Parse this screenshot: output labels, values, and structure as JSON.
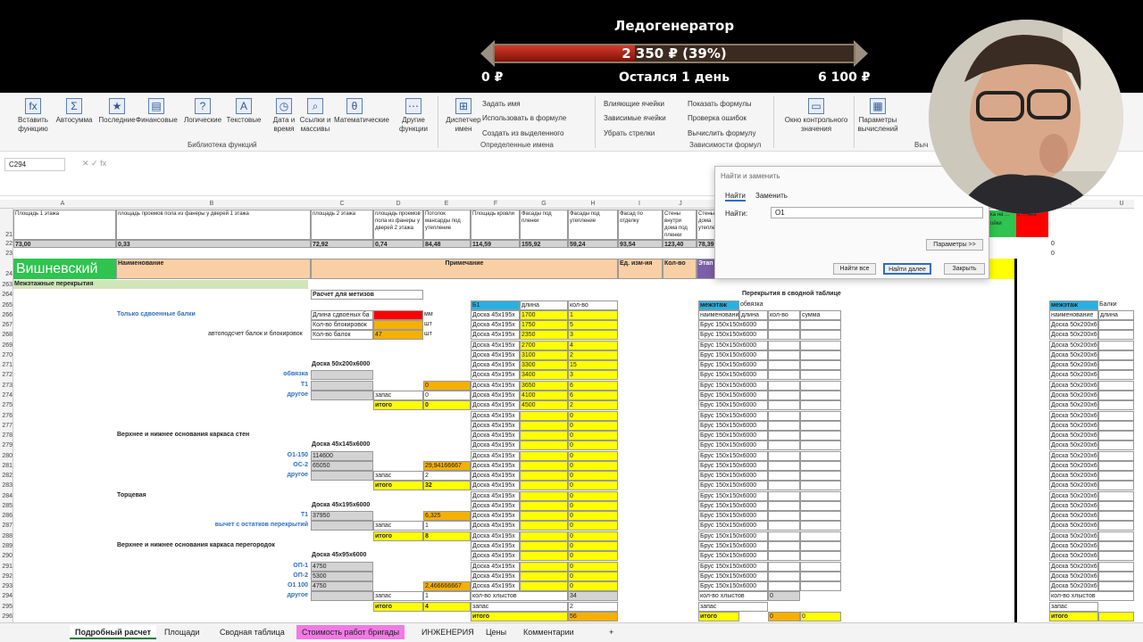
{
  "overlay": {
    "title": "Ледогенератор",
    "progress_text": "2 350 ₽ (39%)",
    "progress_fraction": 0.39,
    "min_label": "0 ₽",
    "remaining": "Остался 1 день",
    "max_label": "6 100 ₽"
  },
  "ribbon": {
    "buttons": [
      {
        "icon": "fx",
        "label": "Вставить функцию"
      },
      {
        "icon": "Σ",
        "label": "Автосумма"
      },
      {
        "icon": "★",
        "label": "Последние"
      },
      {
        "icon": "▤",
        "label": "Финансовые"
      },
      {
        "icon": "?",
        "label": "Логические"
      },
      {
        "icon": "A",
        "label": "Текстовые"
      },
      {
        "icon": "◷",
        "label": "Дата и время"
      },
      {
        "icon": "⌕",
        "label": "Ссылки и массивы"
      },
      {
        "icon": "θ",
        "label": "Математические"
      },
      {
        "icon": "⋯",
        "label": "Другие функции"
      },
      {
        "icon": "⊞",
        "label": "Диспетчер имен"
      },
      {
        "icon": "▭",
        "label": "Окно контрольного значения"
      },
      {
        "icon": "▦",
        "label": "Параметры вычислений"
      }
    ],
    "small": [
      "Задать имя",
      "Использовать в формуле",
      "Создать из выделенного",
      "Влияющие ячейки",
      "Зависимые ячейки",
      "Убрать стрелки",
      "Показать формулы",
      "Проверка ошибок",
      "Вычислить формулу"
    ],
    "groups": [
      "Библиотека функций",
      "Определенные имена",
      "Зависимости формул",
      "Выч"
    ]
  },
  "formula_bar": {
    "cell": "C294",
    "fx": "fx"
  },
  "columns": [
    "A",
    "B",
    "C",
    "D",
    "E",
    "F",
    "G",
    "H",
    "I",
    "J",
    "T",
    "U"
  ],
  "rows": [
    "21",
    "22",
    "23",
    "24",
    "263",
    "264",
    "265",
    "266",
    "267",
    "268",
    "269",
    "270",
    "271",
    "272",
    "273",
    "274",
    "275",
    "276",
    "277",
    "278",
    "279",
    "280",
    "281",
    "282",
    "283",
    "284",
    "285",
    "286",
    "287",
    "288",
    "289",
    "290",
    "291",
    "292",
    "293",
    "294",
    "295",
    "296"
  ],
  "header": {
    "a": "Площадь 1 этажа",
    "b": "площадь проемов пола из фанеры у дверей 1 этажа",
    "c": "площадь 2 этажа",
    "d": "площадь проемов пола из фанеры у дверей 2 этажа",
    "e": "Потолок мансарды под утепление",
    "f": "Площадь кровли",
    "g": "Фасады под пленки",
    "h": "Фасады под утепление",
    "i": "Фасад по отделку",
    "j": "Стены внутри дома под пленки",
    "k": "Стены дома утепле"
  },
  "vals22": {
    "a": "73,00",
    "b": "0,33",
    "c": "72,92",
    "d": "0,74",
    "e": "84,48",
    "f": "114,59",
    "g": "155,92",
    "h": "59,24",
    "i": "93,54",
    "j": "123,40",
    "k": "78,39"
  },
  "t22": "0",
  "t23": "0",
  "right_hdr": {
    "g": "ка на ... ойки",
    "r": "о ... ние"
  },
  "table_hdr": {
    "brand": "Вишневский",
    "name": "Наименование",
    "note": "Примечание",
    "unit": "Ед. изм-ия",
    "qty": "Кол-во",
    "stage": "Этап стро"
  },
  "section": "Межэтажные перекрытия",
  "calc": {
    "title": "Расчет для метизов",
    "l1": "Только сдвоенные балки",
    "l2": "автоподсчет балок и блокировок",
    "r266": "Длина сдвоеных ба",
    "r267": "Кол-во блокировок",
    "r268": "Кол-во балок",
    "v268": "47",
    "u266": "мм",
    "u267": "шт",
    "u268": "шт"
  },
  "b1": {
    "h1": "Б1",
    "h2": "длина",
    "h3": "кол-во",
    "name": "Доска 45х195х",
    "rows": [
      [
        "1700",
        "1"
      ],
      [
        "1750",
        "5"
      ],
      [
        "2350",
        "3"
      ],
      [
        "2700",
        "4"
      ],
      [
        "3100",
        "2"
      ],
      [
        "3300",
        "15"
      ],
      [
        "3400",
        "3"
      ],
      [
        "3650",
        "6"
      ],
      [
        "4100",
        "6"
      ],
      [
        "4500",
        "2"
      ],
      [
        "",
        "0"
      ],
      [
        "",
        "0"
      ],
      [
        "",
        "0"
      ],
      [
        "",
        "0"
      ],
      [
        "",
        "0"
      ],
      [
        "",
        "0"
      ],
      [
        "",
        "0"
      ],
      [
        "",
        "0"
      ],
      [
        "",
        "0"
      ],
      [
        "",
        "0"
      ],
      [
        "",
        "0"
      ],
      [
        "",
        "0"
      ],
      [
        "",
        "0"
      ],
      [
        "",
        "0"
      ],
      [
        "",
        "0"
      ],
      [
        "",
        "0"
      ],
      [
        "",
        "0"
      ],
      [
        "",
        "0"
      ]
    ],
    "count": "кол-во хлыстов",
    "count_val": "34",
    "zapas": "запас",
    "zapas_val": "2",
    "itogo": "итого",
    "itogo_val": "56"
  },
  "left": [
    {
      "row": "271",
      "b": "Доска 50х200х6000"
    },
    {
      "row": "272",
      "a": "обвязка"
    },
    {
      "row": "273",
      "a": "Т1",
      "e": "0"
    },
    {
      "row": "274",
      "a": "другое",
      "d": "запас",
      "e": "0"
    },
    {
      "row": "275",
      "d": "итого",
      "e": "0"
    },
    {
      "row": "278",
      "h": "Верхнее и нижнее основания каркаса стен"
    },
    {
      "row": "279",
      "b": "Доска 45х145х6000"
    },
    {
      "row": "280",
      "a": "О1-150",
      "c": "114600"
    },
    {
      "row": "281",
      "a": "ОС-2",
      "c": "65050",
      "e": "29,94166667"
    },
    {
      "row": "282",
      "a": "другое",
      "d": "запас",
      "e": "2"
    },
    {
      "row": "283",
      "d": "итого",
      "e": "32"
    },
    {
      "row": "284",
      "h": "Торцевая"
    },
    {
      "row": "285",
      "b": "Доска 45х195х6000"
    },
    {
      "row": "286",
      "a": "Т1",
      "c": "37950",
      "e": "6,325"
    },
    {
      "row": "287",
      "a": "вычет с остатков перекрытий",
      "d": "запас",
      "e": "1"
    },
    {
      "row": "288",
      "d": "итого",
      "e": "8"
    },
    {
      "row": "289",
      "h": "Верхнее и нижнее основания каркаса перегородок"
    },
    {
      "row": "290",
      "b": "Доска 45х95х6000"
    },
    {
      "row": "291",
      "a": "ОП-1",
      "c": "4750"
    },
    {
      "row": "292",
      "a": "ОП-2",
      "c": "5300"
    },
    {
      "row": "293",
      "a": "О1 100",
      "c": "4750",
      "e": "2,466666667"
    },
    {
      "row": "294",
      "a": "другое",
      "d": "запас",
      "e": "1"
    },
    {
      "row": "295",
      "d": "итого",
      "e": "4"
    }
  ],
  "svod": {
    "title": "Перекрытия в сводной таблице",
    "h": "межэтаж",
    "obv": "обвязка",
    "cols": [
      "наименовани",
      "длина",
      "кол-во",
      "сумма"
    ],
    "brus": "Брус 150х150х6000",
    "count": "кол-во хлыстов",
    "count_val": "0",
    "zapas": "запас",
    "itogo": "итого",
    "itogo_val": "0",
    "itogo_sum": "0"
  },
  "far": {
    "h1": "межэтаж",
    "h2": "Балки",
    "c1": "наименование",
    "c2": "длина",
    "item": "Доска 50х200х6000",
    "count": "кол-во хлыстов",
    "zapas": "запас",
    "itogo": "итого"
  },
  "dialog": {
    "title": "Найти и заменить",
    "tab_find": "Найти",
    "tab_replace": "Заменить",
    "label": "Найти:",
    "value": "О1",
    "params": "Параметры >>",
    "find_all": "Найти все",
    "find_next": "Найти далее",
    "close": "Закрыть"
  },
  "sheets": [
    "Подробный расчет",
    "Площади",
    "Сводная таблица",
    "Стоимость работ бригады",
    "ИНЖЕНЕРИЯ",
    "Цены",
    "Комментарии",
    "+"
  ]
}
